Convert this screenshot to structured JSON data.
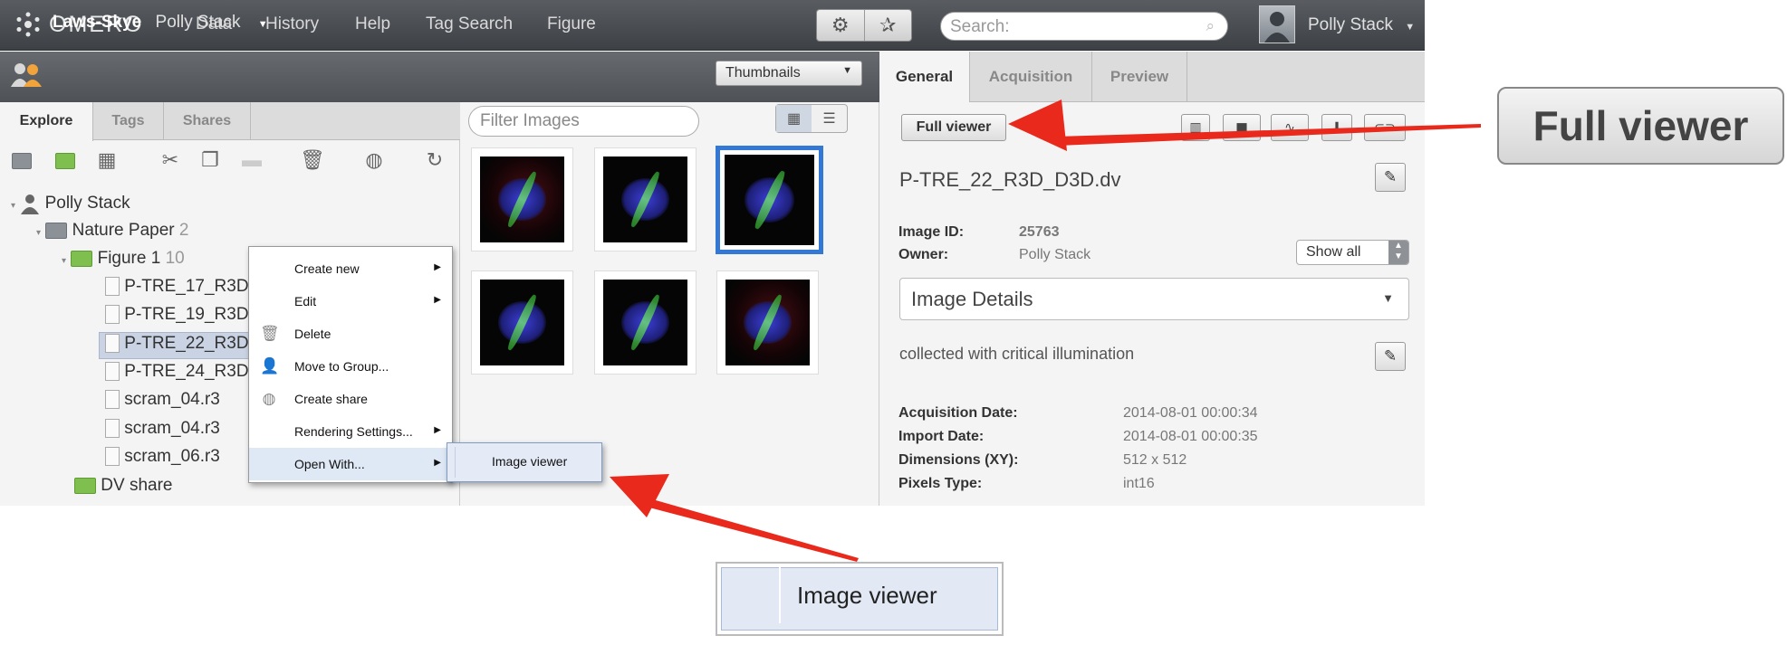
{
  "header": {
    "logo_text": "OMERO",
    "nav": [
      "Data",
      "History",
      "Help",
      "Tag Search",
      "Figure"
    ],
    "search_placeholder": "Search:",
    "user_name": "Polly Stack"
  },
  "group": {
    "name": "Laws-Skye",
    "user": "Polly Stack"
  },
  "left_tabs": [
    "Explore",
    "Tags",
    "Shares"
  ],
  "tree": {
    "root": "Polly Stack",
    "project": {
      "name": "Nature Paper",
      "count": "2"
    },
    "dataset": {
      "name": "Figure 1",
      "count": "10"
    },
    "images": [
      "P-TRE_17_R3D",
      "P-TRE_19_R3D",
      "P-TRE_22_R3D",
      "P-TRE_24_R3D",
      "scram_04.r3",
      "scram_04.r3",
      "scram_06.r3"
    ],
    "share": "DV share"
  },
  "center": {
    "view_select": "Thumbnails",
    "filter_placeholder": "Filter Images"
  },
  "right_tabs": [
    "General",
    "Acquisition",
    "Preview"
  ],
  "details": {
    "full_viewer_label": "Full viewer",
    "image_name": "P-TRE_22_R3D_D3D.dv",
    "image_id_label": "Image ID:",
    "image_id": "25763",
    "owner_label": "Owner:",
    "owner": "Polly Stack",
    "show_all": "Show all",
    "section_title": "Image Details",
    "description": "collected with critical illumination",
    "rows": [
      {
        "label": "Acquisition Date:",
        "value": "2014-08-01 00:00:34"
      },
      {
        "label": "Import Date:",
        "value": "2014-08-01 00:00:35"
      },
      {
        "label": "Dimensions (XY):",
        "value": "512 x 512"
      },
      {
        "label": "Pixels Type:",
        "value": "int16"
      }
    ]
  },
  "context_menu": {
    "items": [
      "Create new",
      "Edit",
      "Delete",
      "Move to Group...",
      "Create share",
      "Rendering Settings...",
      "Open With..."
    ],
    "submenu_item": "Image viewer"
  },
  "callouts": {
    "full_viewer": "Full viewer",
    "image_viewer": "Image viewer"
  },
  "colors": {
    "accent_arrow": "#e8291c",
    "selection": "#3478d5",
    "topbar": "#4a4e53"
  }
}
